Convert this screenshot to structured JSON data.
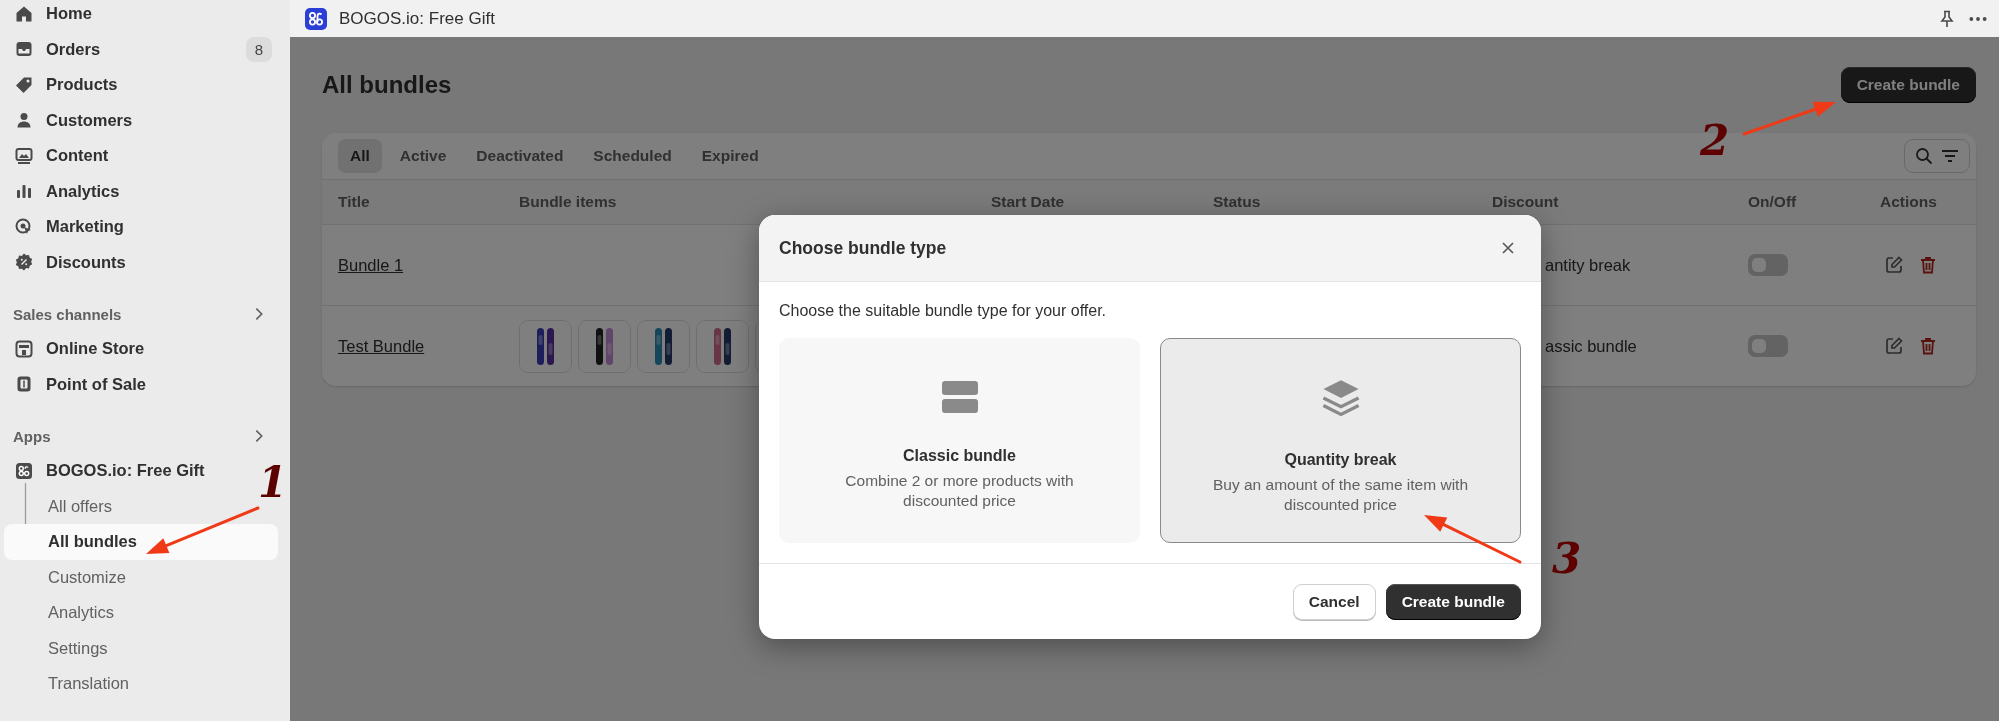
{
  "sidebar": {
    "nav": [
      {
        "label": "Home"
      },
      {
        "label": "Orders",
        "badge": "8"
      },
      {
        "label": "Products"
      },
      {
        "label": "Customers"
      },
      {
        "label": "Content"
      },
      {
        "label": "Analytics"
      },
      {
        "label": "Marketing"
      },
      {
        "label": "Discounts"
      }
    ],
    "sections": [
      {
        "title": "Sales channels",
        "items": [
          {
            "label": "Online Store"
          },
          {
            "label": "Point of Sale"
          }
        ]
      },
      {
        "title": "Apps",
        "items": [
          {
            "label": "BOGOS.io: Free Gift",
            "children": [
              {
                "label": "All offers",
                "selected": false
              },
              {
                "label": "All bundles",
                "selected": true
              },
              {
                "label": "Customize",
                "selected": false
              },
              {
                "label": "Analytics",
                "selected": false
              },
              {
                "label": "Settings",
                "selected": false
              },
              {
                "label": "Translation",
                "selected": false
              }
            ]
          }
        ]
      }
    ]
  },
  "topbar": {
    "title": "BOGOS.io: Free Gift"
  },
  "page": {
    "title": "All bundles",
    "primary_action": "Create bundle"
  },
  "table": {
    "tabs": [
      {
        "label": "All",
        "selected": true
      },
      {
        "label": "Active",
        "selected": false
      },
      {
        "label": "Deactivated",
        "selected": false
      },
      {
        "label": "Scheduled",
        "selected": false
      },
      {
        "label": "Expired",
        "selected": false
      }
    ],
    "columns": [
      "Title",
      "Bundle items",
      "Start Date",
      "Status",
      "Discount",
      "On/Off",
      "Actions"
    ],
    "rows": [
      {
        "title": "Bundle 1",
        "discount": "antity break",
        "on": false
      },
      {
        "title": "Test Bundle",
        "discount": "assic bundle",
        "on": false
      }
    ]
  },
  "modal": {
    "title": "Choose bundle type",
    "description": "Choose the suitable bundle type for your offer.",
    "options": [
      {
        "kind": "classic",
        "title": "Classic bundle",
        "description": "Combine 2 or more products with discounted price",
        "selected": false
      },
      {
        "kind": "quantity",
        "title": "Quantity break",
        "description": "Buy an amount of the same item with discounted price",
        "selected": true
      }
    ],
    "buttons": [
      {
        "kind": "secondary",
        "label": "Cancel"
      },
      {
        "kind": "primary",
        "label": "Create bundle"
      }
    ]
  },
  "annotations": [
    {
      "label": "1"
    },
    {
      "label": "2"
    },
    {
      "label": "3"
    }
  ]
}
